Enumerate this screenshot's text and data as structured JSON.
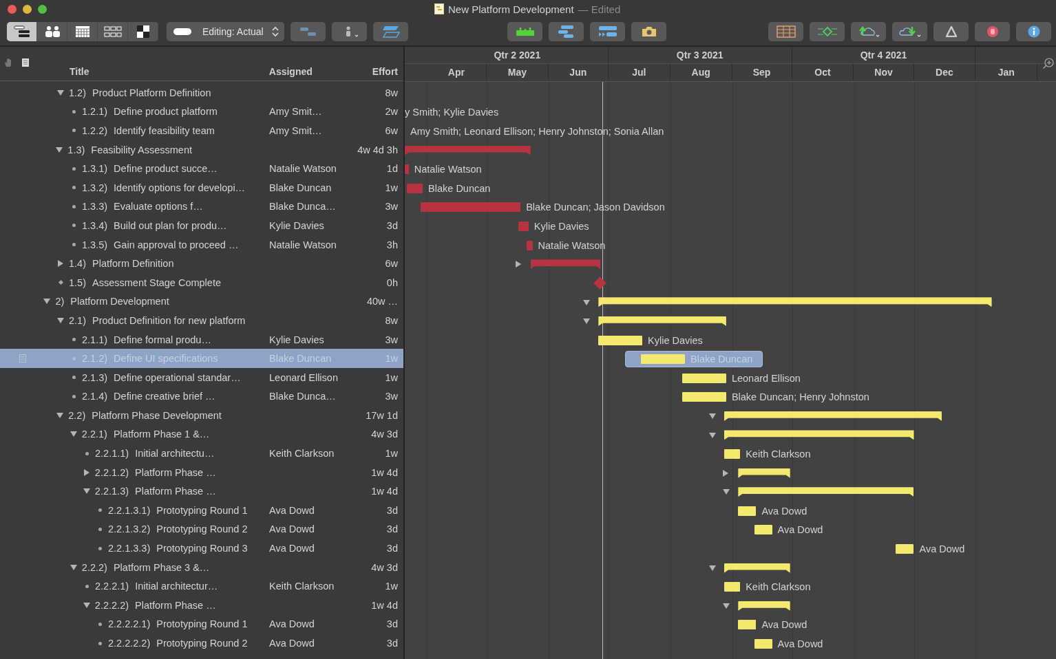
{
  "window": {
    "title": "New Platform Development",
    "edited": "— Edited"
  },
  "toolbar": {
    "view_modes": [
      {
        "kind": "gantt",
        "selected": true
      },
      {
        "kind": "resources",
        "selected": false
      },
      {
        "kind": "calendar",
        "selected": false
      },
      {
        "kind": "network",
        "selected": false
      },
      {
        "kind": "styles",
        "selected": false
      }
    ],
    "editing_popup": "Editing: Actual"
  },
  "columns": [
    "Title",
    "Assigned",
    "Effort"
  ],
  "timeline": {
    "quarters": [
      "Qtr 2 2021",
      "Qtr 3 2021",
      "Qtr 4 2021"
    ],
    "months": [
      "Apr",
      "May",
      "Jun",
      "Jul",
      "Aug",
      "Sep",
      "Oct",
      "Nov",
      "Dec",
      "Jan"
    ]
  },
  "outline": [
    {
      "children": [
        {
          "kind": "group",
          "num": "1.2)",
          "title": "Product Platform Definition",
          "effort": "8w",
          "expanded": true,
          "selected": false,
          "children": [
            {
              "kind": "task",
              "num": "1.2.1)",
              "title": "Define product platform",
              "assigned": "Amy Smit…",
              "effort": "2w",
              "selected": false,
              "label": "y Smith; Kylie Davies"
            },
            {
              "kind": "task",
              "num": "1.2.2)",
              "title": "Identify feasibility team",
              "assigned": "Amy Smit…",
              "effort": "6w",
              "selected": false,
              "label": "Amy Smith; Leonard Ellison; Henry Johnston; Sonia Allan"
            }
          ]
        },
        {
          "kind": "group",
          "num": "1.3)",
          "title": "Feasibility Assessment",
          "effort": "4w 4d 3h",
          "expanded": true,
          "selected": false,
          "color": "#b83340",
          "children": [
            {
              "kind": "task",
              "num": "1.3.1)",
              "title": "Define product succe…",
              "assigned": "Natalie Watson",
              "effort": "1d",
              "selected": false,
              "color": "#b83340",
              "label": "Natalie Watson"
            },
            {
              "kind": "task",
              "num": "1.3.2)",
              "title": "Identify options for developi…",
              "assigned": "Blake Duncan",
              "effort": "1w",
              "selected": false,
              "color": "#b83340",
              "label": "Blake Duncan"
            },
            {
              "kind": "task",
              "num": "1.3.3)",
              "title": "Evaluate options f…",
              "assigned": "Blake Dunca…",
              "effort": "3w",
              "selected": false,
              "color": "#b83340",
              "label": "Blake Duncan; Jason Davidson"
            },
            {
              "kind": "task",
              "num": "1.3.4)",
              "title": "Build out plan for produ…",
              "assigned": "Kylie Davies",
              "effort": "3d",
              "selected": false,
              "color": "#b83340",
              "label": "Kylie Davies"
            },
            {
              "kind": "task",
              "num": "1.3.5)",
              "title": "Gain approval to proceed …",
              "assigned": "Natalie Watson",
              "effort": "3h",
              "selected": false,
              "color": "#b83340",
              "label": "Natalie Watson"
            }
          ]
        },
        {
          "kind": "group",
          "num": "1.4)",
          "title": "Platform Definition",
          "effort": "6w",
          "expanded": false,
          "selected": false,
          "color": "#b83340"
        },
        {
          "kind": "milestone",
          "num": "1.5)",
          "title": "Assessment Stage Complete",
          "effort": "0h",
          "selected": false,
          "color": "#b83340"
        }
      ]
    },
    {
      "kind": "group",
      "num": "2)",
      "title": "Platform Development",
      "effort": "40w …",
      "expanded": true,
      "selected": false,
      "color": "#f2e96e",
      "children": [
        {
          "kind": "group",
          "num": "2.1)",
          "title": "Product Definition for new platform",
          "effort": "8w",
          "expanded": true,
          "selected": false,
          "color": "#f2e96e",
          "children": [
            {
              "kind": "task",
              "num": "2.1.1)",
              "title": "Define formal produ…",
              "assigned": "Kylie Davies",
              "effort": "3w",
              "selected": false,
              "color": "#f2e96e",
              "label": "Kylie Davies"
            },
            {
              "kind": "task",
              "num": "2.1.2)",
              "title": "Define UI specifications",
              "assigned": "Blake Duncan",
              "effort": "1w",
              "selected": true,
              "color": "#f2e96e",
              "label": "Blake Duncan"
            },
            {
              "kind": "task",
              "num": "2.1.3)",
              "title": "Define operational standar…",
              "assigned": "Leonard Ellison",
              "effort": "1w",
              "selected": false,
              "color": "#f2e96e",
              "label": "Leonard Ellison"
            },
            {
              "kind": "task",
              "num": "2.1.4)",
              "title": "Define creative brief …",
              "assigned": "Blake Dunca…",
              "effort": "3w",
              "selected": false,
              "color": "#f2e96e",
              "label": "Blake Duncan; Henry Johnston"
            }
          ]
        },
        {
          "kind": "group",
          "num": "2.2)",
          "title": "Platform Phase Development",
          "effort": "17w 1d",
          "expanded": true,
          "selected": false,
          "color": "#f2e96e",
          "children": [
            {
              "kind": "group",
              "num": "2.2.1)",
              "title": "Platform Phase 1 &…",
              "effort": "4w 3d",
              "expanded": true,
              "selected": false,
              "color": "#f2e96e",
              "children": [
                {
                  "kind": "task",
                  "num": "2.2.1.1)",
                  "title": "Initial architectu…",
                  "assigned": "Keith Clarkson",
                  "effort": "1w",
                  "selected": false,
                  "color": "#f2e96e",
                  "label": "Keith Clarkson"
                },
                {
                  "kind": "group",
                  "num": "2.2.1.2)",
                  "title": "Platform Phase …",
                  "effort": "1w 4d",
                  "expanded": false,
                  "selected": false,
                  "color": "#f2e96e"
                },
                {
                  "kind": "group",
                  "num": "2.2.1.3)",
                  "title": "Platform Phase …",
                  "effort": "1w 4d",
                  "expanded": true,
                  "selected": false,
                  "color": "#f2e96e",
                  "children": [
                    {
                      "kind": "task",
                      "num": "2.2.1.3.1)",
                      "title": "Prototyping Round 1",
                      "assigned": "Ava Dowd",
                      "effort": "3d",
                      "selected": false,
                      "color": "#f2e96e",
                      "label": "Ava Dowd"
                    },
                    {
                      "kind": "task",
                      "num": "2.2.1.3.2)",
                      "title": "Prototyping Round 2",
                      "assigned": "Ava Dowd",
                      "effort": "3d",
                      "selected": false,
                      "color": "#f2e96e",
                      "label": "Ava Dowd"
                    },
                    {
                      "kind": "task",
                      "num": "2.2.1.3.3)",
                      "title": "Prototyping Round 3",
                      "assigned": "Ava Dowd",
                      "effort": "3d",
                      "selected": false,
                      "color": "#f2e96e",
                      "label": "Ava Dowd"
                    }
                  ]
                }
              ]
            },
            {
              "kind": "group",
              "num": "2.2.2)",
              "title": "Platform Phase 3 &…",
              "effort": "4w 3d",
              "expanded": true,
              "selected": false,
              "color": "#f2e96e",
              "children": [
                {
                  "kind": "task",
                  "num": "2.2.2.1)",
                  "title": "Initial architectur…",
                  "assigned": "Keith Clarkson",
                  "effort": "1w",
                  "selected": false,
                  "color": "#f2e96e",
                  "label": "Keith Clarkson"
                },
                {
                  "kind": "group",
                  "num": "2.2.2.2)",
                  "title": "Platform Phase …",
                  "effort": "1w 4d",
                  "expanded": true,
                  "selected": false,
                  "color": "#f2e96e",
                  "children": [
                    {
                      "kind": "task",
                      "num": "2.2.2.2.1)",
                      "title": "Prototyping Round 1",
                      "assigned": "Ava Dowd",
                      "effort": "3d",
                      "selected": false,
                      "color": "#f2e96e",
                      "label": "Ava Dowd"
                    },
                    {
                      "kind": "task",
                      "num": "2.2.2.2.2)",
                      "title": "Prototyping Round 2",
                      "assigned": "Ava Dowd",
                      "effort": "3d",
                      "selected": false,
                      "color": "#f2e96e",
                      "label": "Ava Dowd"
                    }
                  ]
                }
              ]
            }
          ]
        }
      ]
    }
  ]
}
